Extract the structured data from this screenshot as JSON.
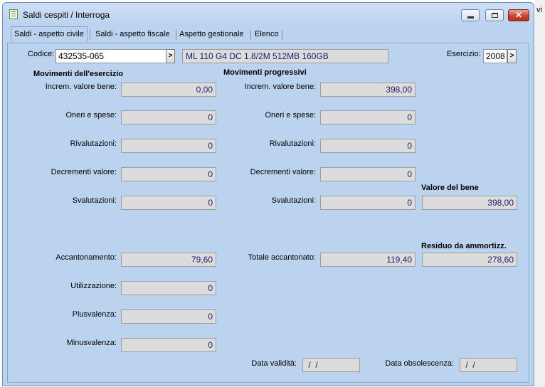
{
  "background_edge_text": "vi",
  "window": {
    "title": "Saldi cespiti / Interroga"
  },
  "tabs": [
    {
      "label": "Saldi - aspetto civile",
      "active": true
    },
    {
      "label": "Saldi - aspetto fiscale",
      "active": false
    },
    {
      "label": "Aspetto gestionale",
      "active": false
    },
    {
      "label": "Elenco",
      "active": false
    }
  ],
  "header": {
    "codice_label": "Codice:",
    "codice_value": "432535-065",
    "lookup_symbol": ">",
    "description": "ML 110 G4 DC 1.8/2M 512MB 160GB",
    "esercizio_label": "Esercizio:",
    "esercizio_value": "2008",
    "esercizio_symbol": ">"
  },
  "movimenti_esercizio": {
    "title": "Movimenti dell'esercizio",
    "increm_label": "Increm. valore bene:",
    "increm_value": "0,00",
    "oneri_label": "Oneri e spese:",
    "oneri_value": "0",
    "rivalutazioni_label": "Rivalutazioni:",
    "rivalutazioni_value": "0",
    "decrementi_label": "Decrementi valore:",
    "decrementi_value": "0",
    "svalutazioni_label": "Svalutazioni:",
    "svalutazioni_value": "0",
    "accantonamento_label": "Accantonamento:",
    "accantonamento_value": "79,60",
    "utilizzazione_label": "Utilizzazione:",
    "utilizzazione_value": "0",
    "plusvalenza_label": "Plusvalenza:",
    "plusvalenza_value": "0",
    "minusvalenza_label": "Minusvalenza:",
    "minusvalenza_value": "0"
  },
  "movimenti_progressivi": {
    "title": "Movimenti progressivi",
    "increm_label": "Increm. valore bene:",
    "increm_value": "398,00",
    "oneri_label": "Oneri e spese:",
    "oneri_value": "0",
    "rivalutazioni_label": "Rivalutazioni:",
    "rivalutazioni_value": "0",
    "decrementi_label": "Decrementi valore:",
    "decrementi_value": "0",
    "svalutazioni_label": "Svalutazioni:",
    "svalutazioni_value": "0",
    "totale_label": "Totale accantonato:",
    "totale_value": "119,40"
  },
  "valore_bene": {
    "title": "Valore del bene",
    "value": "398,00"
  },
  "residuo": {
    "title": "Residuo da ammortizz.",
    "value": "278,60"
  },
  "footer": {
    "validita_label": "Data validità:",
    "validita_value": " /  /",
    "obsolescenza_label": "Data obsolescenza:",
    "obsolescenza_value": " /  /"
  }
}
